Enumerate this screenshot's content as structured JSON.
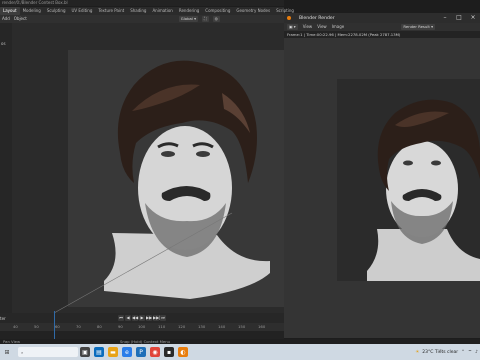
{
  "main": {
    "title": "render/0:/Blender Contest Box.bl",
    "workspace_tabs": [
      "Layout",
      "Modeling",
      "Sculpting",
      "UV Editing",
      "Texture Paint",
      "Shading",
      "Animation",
      "Rendering",
      "Compositing",
      "Geometry Nodes",
      "Scripting"
    ],
    "header": {
      "add": "Add",
      "object": "Object",
      "orientation": "Global"
    },
    "viewport_label": "os"
  },
  "timeline": {
    "label": "ter",
    "ruler_ticks": [
      "40",
      "50",
      "60",
      "70",
      "80",
      "90",
      "100",
      "110",
      "120",
      "130",
      "140",
      "150",
      "160",
      "170",
      "180",
      "190",
      "200",
      "210"
    ],
    "playback_buttons": [
      "⏮",
      "◀",
      "◀◀",
      "▶",
      "▶▶",
      "▶▶|",
      "⏭"
    ]
  },
  "status": {
    "left": "Pan View",
    "center": "Snap (Hold) Context Menu"
  },
  "render_window": {
    "title": "Blender Render",
    "menu": [
      "View",
      "View",
      "Image"
    ],
    "slot_label": "Render Result",
    "info": "Frame:1 | Time:00:22.96 | Mem:2278.02M (Peak 2787.13M)"
  },
  "taskbar": {
    "search_placeholder": "",
    "weather": "23°C  Tiếts clear",
    "tray_icons": [
      "chevron-up-icon",
      "network-icon",
      "volume-icon"
    ]
  }
}
